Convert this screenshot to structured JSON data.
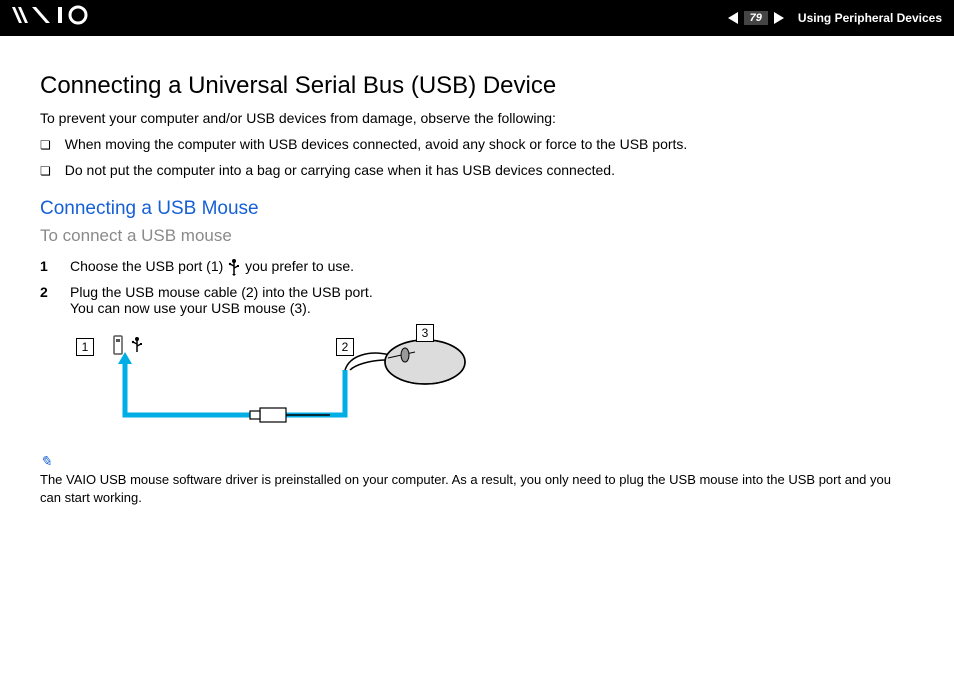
{
  "header": {
    "logo_alt": "VAIO",
    "page_number": "79",
    "section": "Using Peripheral Devices"
  },
  "h1": "Connecting a Universal Serial Bus (USB) Device",
  "intro": "To prevent your computer and/or USB devices from damage, observe the following:",
  "bullets": [
    "When moving the computer with USB devices connected, avoid any shock or force to the USB ports.",
    "Do not put the computer into a bag or carrying case when it has USB devices connected."
  ],
  "h2": "Connecting a USB Mouse",
  "subhead": "To connect a USB mouse",
  "steps": [
    {
      "n": "1",
      "text_before": "Choose the USB port (1) ",
      "text_after": " you prefer to use."
    },
    {
      "n": "2",
      "text_before": "Plug the USB mouse cable (2) into the USB port.\nYou can now use your USB mouse (3).",
      "text_after": ""
    }
  ],
  "diagram": {
    "callouts": [
      "1",
      "2",
      "3"
    ]
  },
  "note_symbol": "✎",
  "note": "The VAIO USB mouse software driver is preinstalled on your computer. As a result, you only need to plug the USB mouse into the USB port and you can start working."
}
